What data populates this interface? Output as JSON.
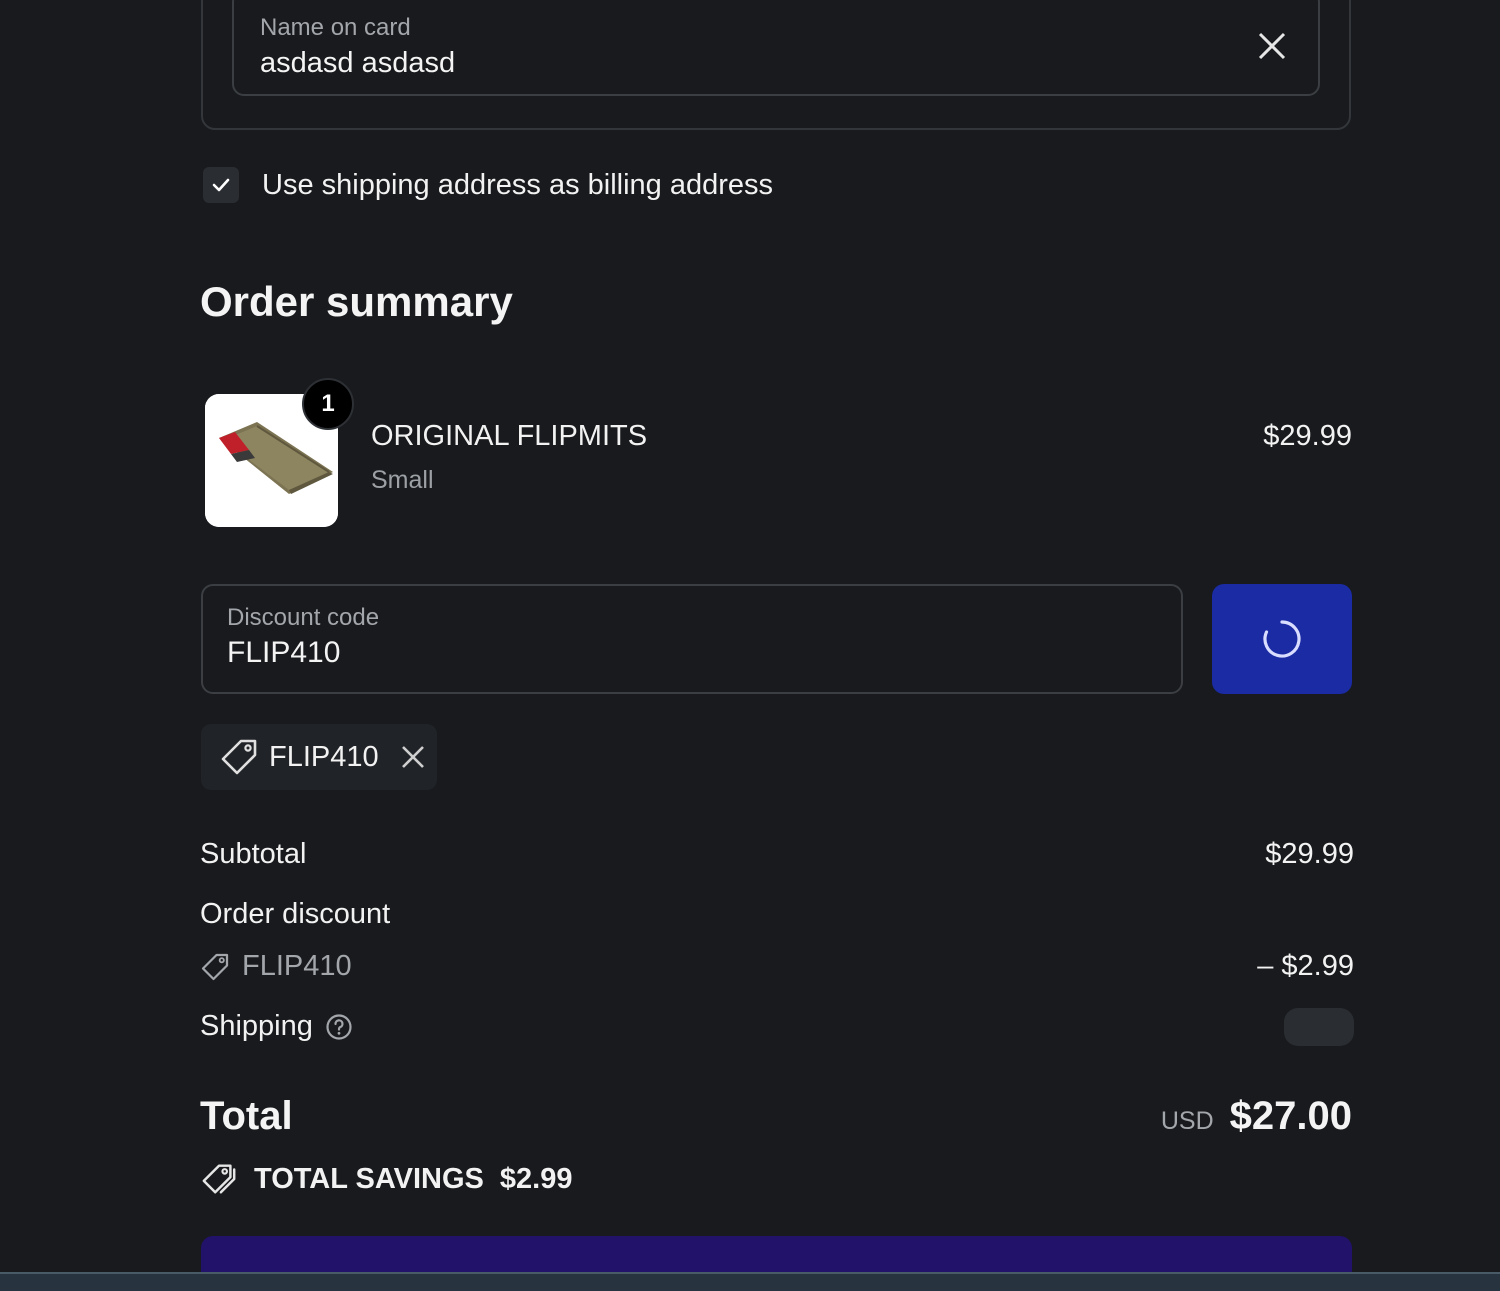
{
  "payment": {
    "name_on_card_label": "Name on card",
    "name_on_card_value": "asdasd asdasd",
    "billing_checkbox_label": "Use shipping address as billing address",
    "billing_checkbox_checked": true
  },
  "order_summary": {
    "title": "Order summary",
    "items": [
      {
        "quantity": "1",
        "name": "ORIGINAL FLIPMITS",
        "variant": "Small",
        "price": "$29.99"
      }
    ],
    "discount_field": {
      "label": "Discount code",
      "value": "FLIP410"
    },
    "applied_discount_chip": "FLIP410",
    "subtotal_label": "Subtotal",
    "subtotal_value": "$29.99",
    "order_discount_label": "Order discount",
    "order_discount_code": "FLIP410",
    "order_discount_value": "– $2.99",
    "shipping_label": "Shipping",
    "total_label": "Total",
    "total_currency": "USD",
    "total_value": "$27.00",
    "total_savings_label": "TOTAL SAVINGS",
    "total_savings_value": "$2.99"
  },
  "colors": {
    "background": "#181a1d",
    "apply_button": "#1b2ba3",
    "pay_button": "#22126a",
    "field_border": "#3b3e43",
    "muted_text": "#a3a6ab"
  }
}
